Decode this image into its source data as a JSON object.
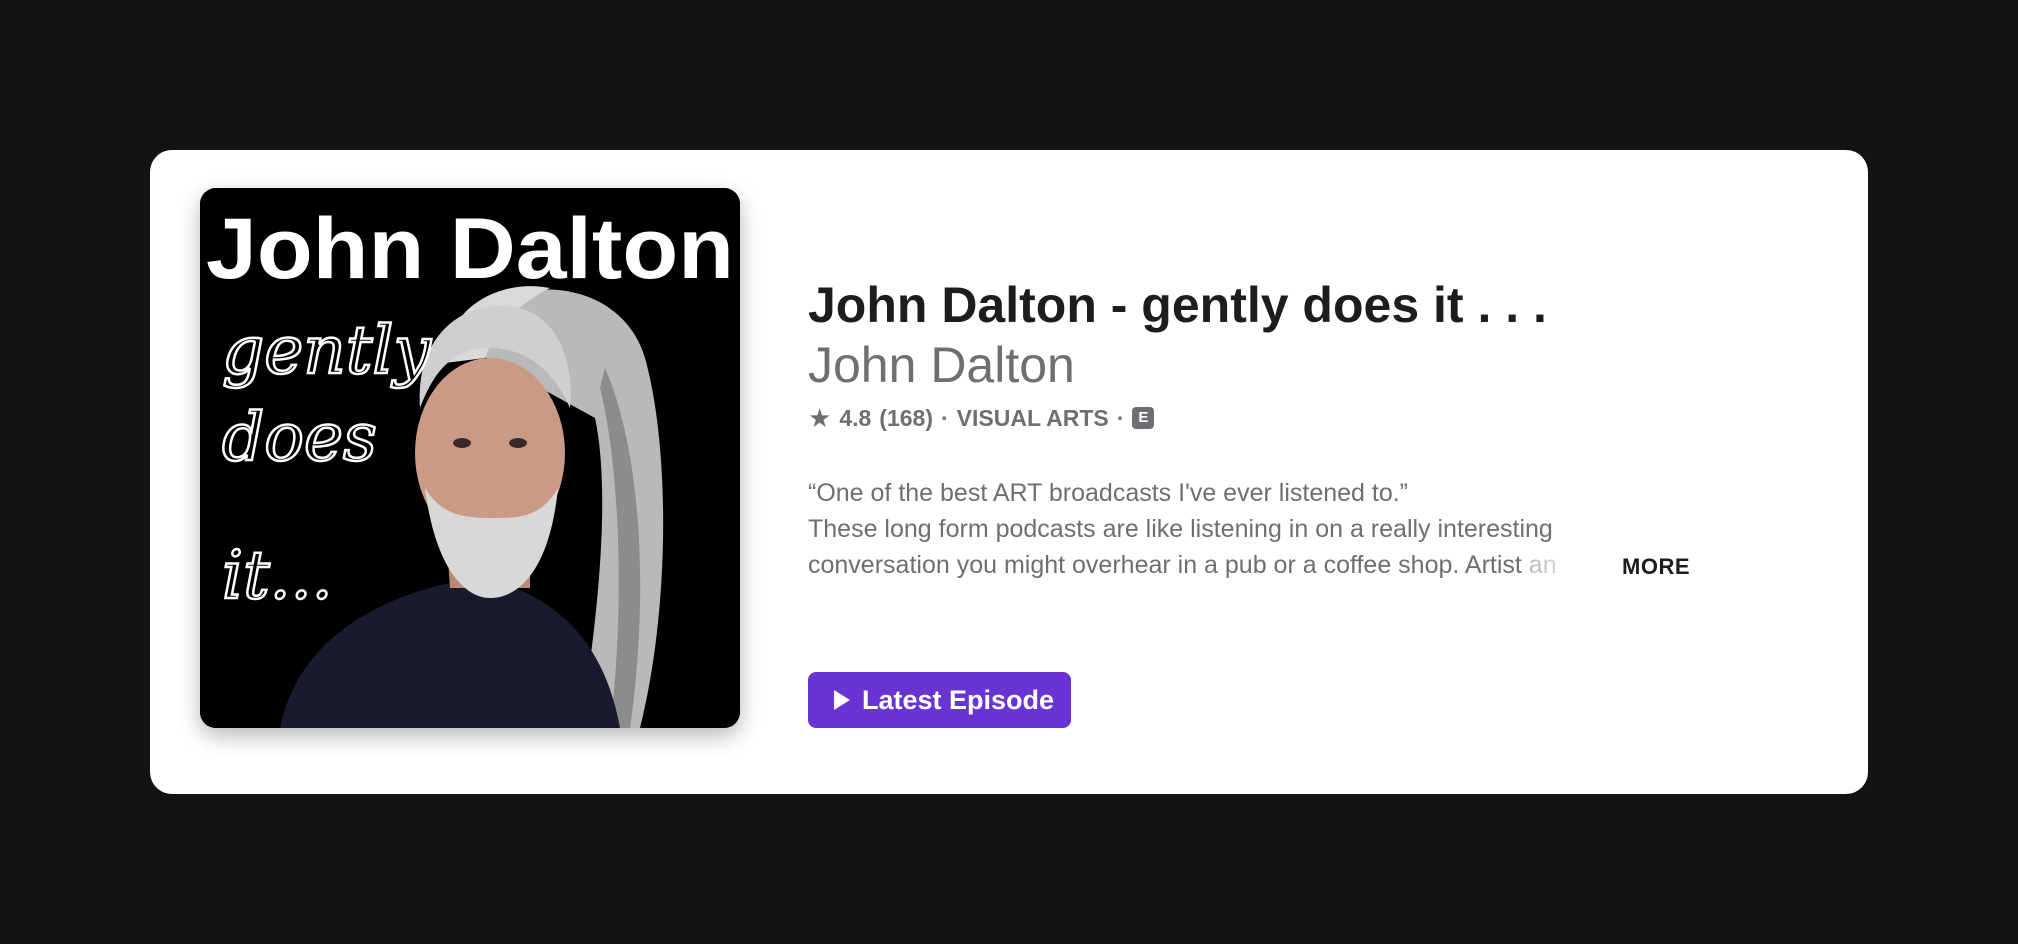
{
  "podcast": {
    "title": "John Dalton - gently does it . . .",
    "artist": "John Dalton",
    "rating": "4.8",
    "rating_count": "(168)",
    "separator": "·",
    "category": "VISUAL ARTS",
    "explicit_badge": "E",
    "star_icon": "star-icon"
  },
  "artwork": {
    "heading": "John Dalton",
    "line1": "gently",
    "line2": "does",
    "line3": "it..."
  },
  "description": {
    "line1": "“One of the best ART broadcasts I've ever listened to.”",
    "line2": "These long form podcasts are like listening in on a really interesting",
    "line3": "conversation you might overhear in a pub or a coffee shop. Artist",
    "line3_faded": "an",
    "more_label": "MORE"
  },
  "actions": {
    "latest_episode_label": "Latest Episode",
    "play_icon": "play-icon"
  },
  "colors": {
    "background": "#131313",
    "card": "#ffffff",
    "accent": "#6a34d5",
    "secondary_text": "#6e6e73"
  }
}
